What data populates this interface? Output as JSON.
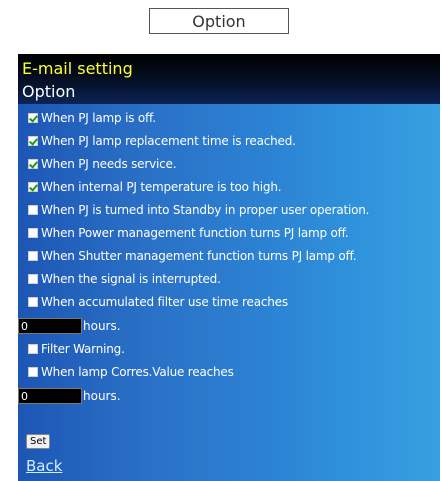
{
  "top_tab": {
    "label": "Option"
  },
  "header": {
    "title": "E-mail setting",
    "subtitle": "Option"
  },
  "options": [
    {
      "label": "When PJ lamp is off.",
      "checked": true
    },
    {
      "label": "When PJ lamp replacement time is reached.",
      "checked": true
    },
    {
      "label": "When PJ needs service.",
      "checked": true
    },
    {
      "label": "When internal PJ temperature is too high.",
      "checked": true
    },
    {
      "label": "When PJ is turned into Standby in proper user operation.",
      "checked": false
    },
    {
      "label": "When Power management function turns PJ lamp off.",
      "checked": false
    },
    {
      "label": "When Shutter management function turns PJ lamp off.",
      "checked": false
    },
    {
      "label": "When the signal is interrupted.",
      "checked": false
    },
    {
      "label": "When accumulated filter use time reaches",
      "checked": false
    }
  ],
  "filter_hours": {
    "value": "0",
    "unit": "hours."
  },
  "filter_warning": {
    "label": "Filter Warning.",
    "checked": false
  },
  "lamp_corres": {
    "label": "When lamp Corres.Value reaches",
    "checked": false
  },
  "lamp_hours": {
    "value": "0",
    "unit": "hours."
  },
  "set_button": {
    "label": "Set"
  },
  "back_link": {
    "label": "Back"
  },
  "colors": {
    "header_title": "#ffff33",
    "panel_blue": "#2a70c6",
    "check_green": "#1a9a1a"
  }
}
